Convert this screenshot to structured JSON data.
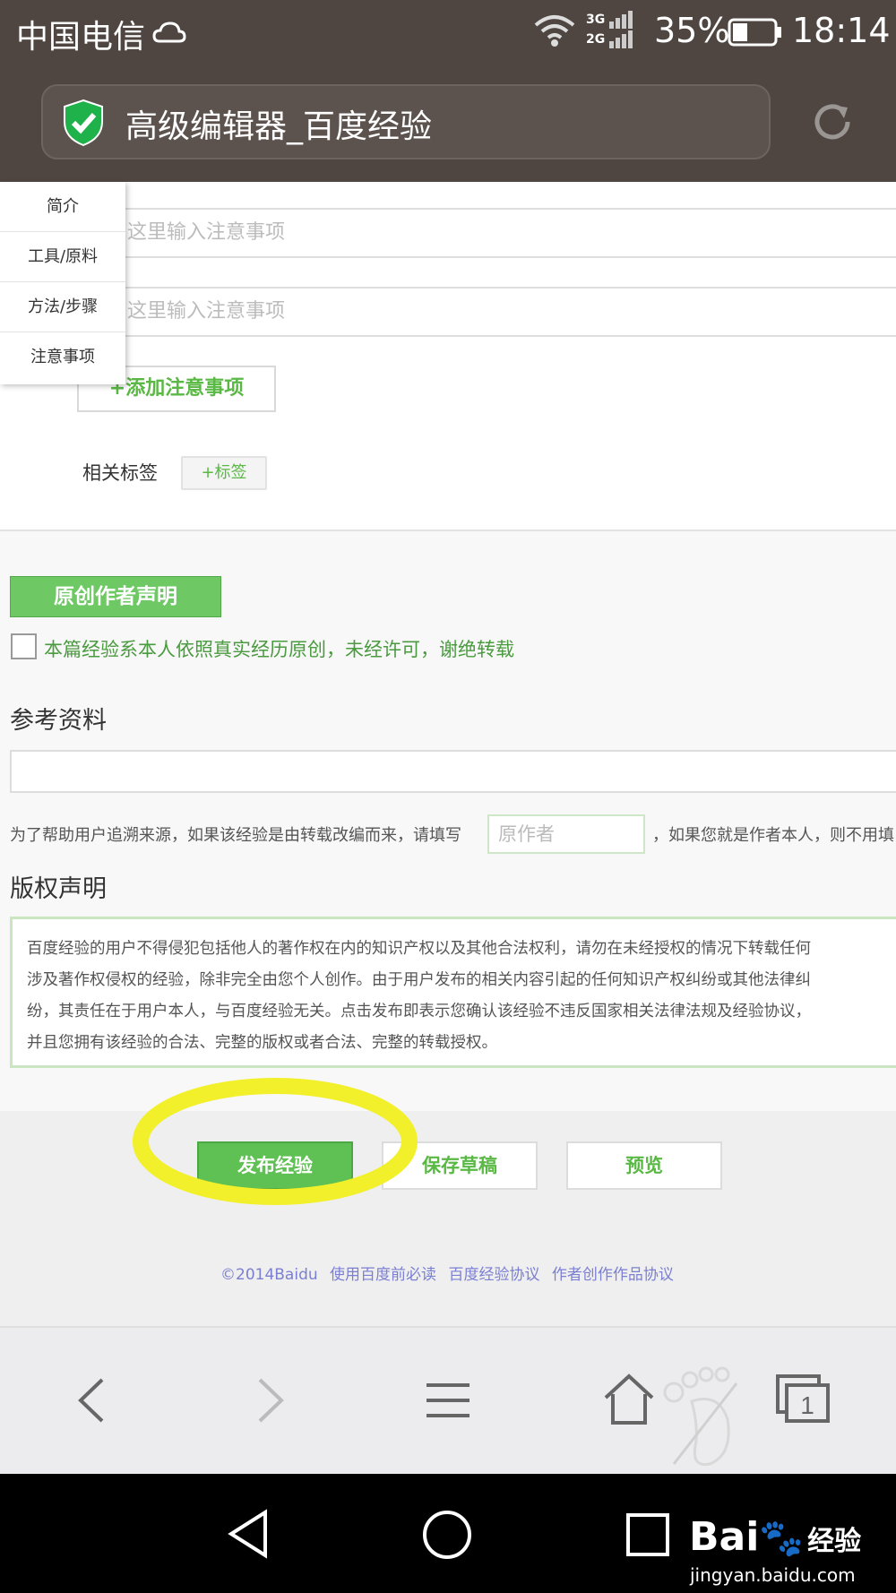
{
  "status_bar": {
    "carrier": "中国电信",
    "battery_percent": "35%",
    "time": "18:14"
  },
  "browser": {
    "page_title": "高级编辑器_百度经验"
  },
  "side_nav": {
    "items": [
      "简介",
      "工具/原料",
      "方法/步骤",
      "注意事项"
    ]
  },
  "notes": {
    "placeholders": [
      "这里输入注意事项",
      "这里输入注意事项"
    ],
    "add_label": "+添加注意事项"
  },
  "tags": {
    "label": "相关标签",
    "add_label": "+标签"
  },
  "originality": {
    "badge": "原创作者声明",
    "checkbox_checked": false,
    "statement": "本篇经验系本人依照真实经历原创，未经许可，谢绝转载"
  },
  "reference": {
    "heading": "参考资料",
    "value": "",
    "help_before": "为了帮助用户追溯来源，如果该经验是由转载改编而来，请填写",
    "author_placeholder": "原作者",
    "help_after": "，如果您就是作者本人，则不用填"
  },
  "copyright": {
    "heading": "版权声明",
    "lines": [
      "百度经验的用户不得侵犯包括他人的著作权在内的知识产权以及其他合法权利，请勿在未经授权的情况下转载任何",
      "涉及著作权侵权的经验，除非完全由您个人创作。由于用户发布的相关内容引起的任何知识产权纠纷或其他法律纠",
      "纷，其责任在于用户本人，与百度经验无关。点击发布即表示您确认该经验不违反国家相关法律法规及经验协议，",
      "并且您拥有该经验的合法、完整的版权或者合法、完整的转载授权。"
    ]
  },
  "actions": {
    "publish": "发布经验",
    "save_draft": "保存草稿",
    "preview": "预览"
  },
  "footer": {
    "links": [
      "©2014Baidu",
      "使用百度前必读",
      "百度经验协议",
      "作者创作作品协议"
    ]
  },
  "browser_nav": {
    "tab_count": "1"
  },
  "watermark": {
    "brand": "Bai",
    "brand_suffix": "经验",
    "url": "jingyan.baidu.com"
  },
  "colors": {
    "brand_green": "#5fc053",
    "header_brown": "#4f4641",
    "link_purple": "#7b7fd1",
    "highlight_yellow": "#f2f02a"
  }
}
